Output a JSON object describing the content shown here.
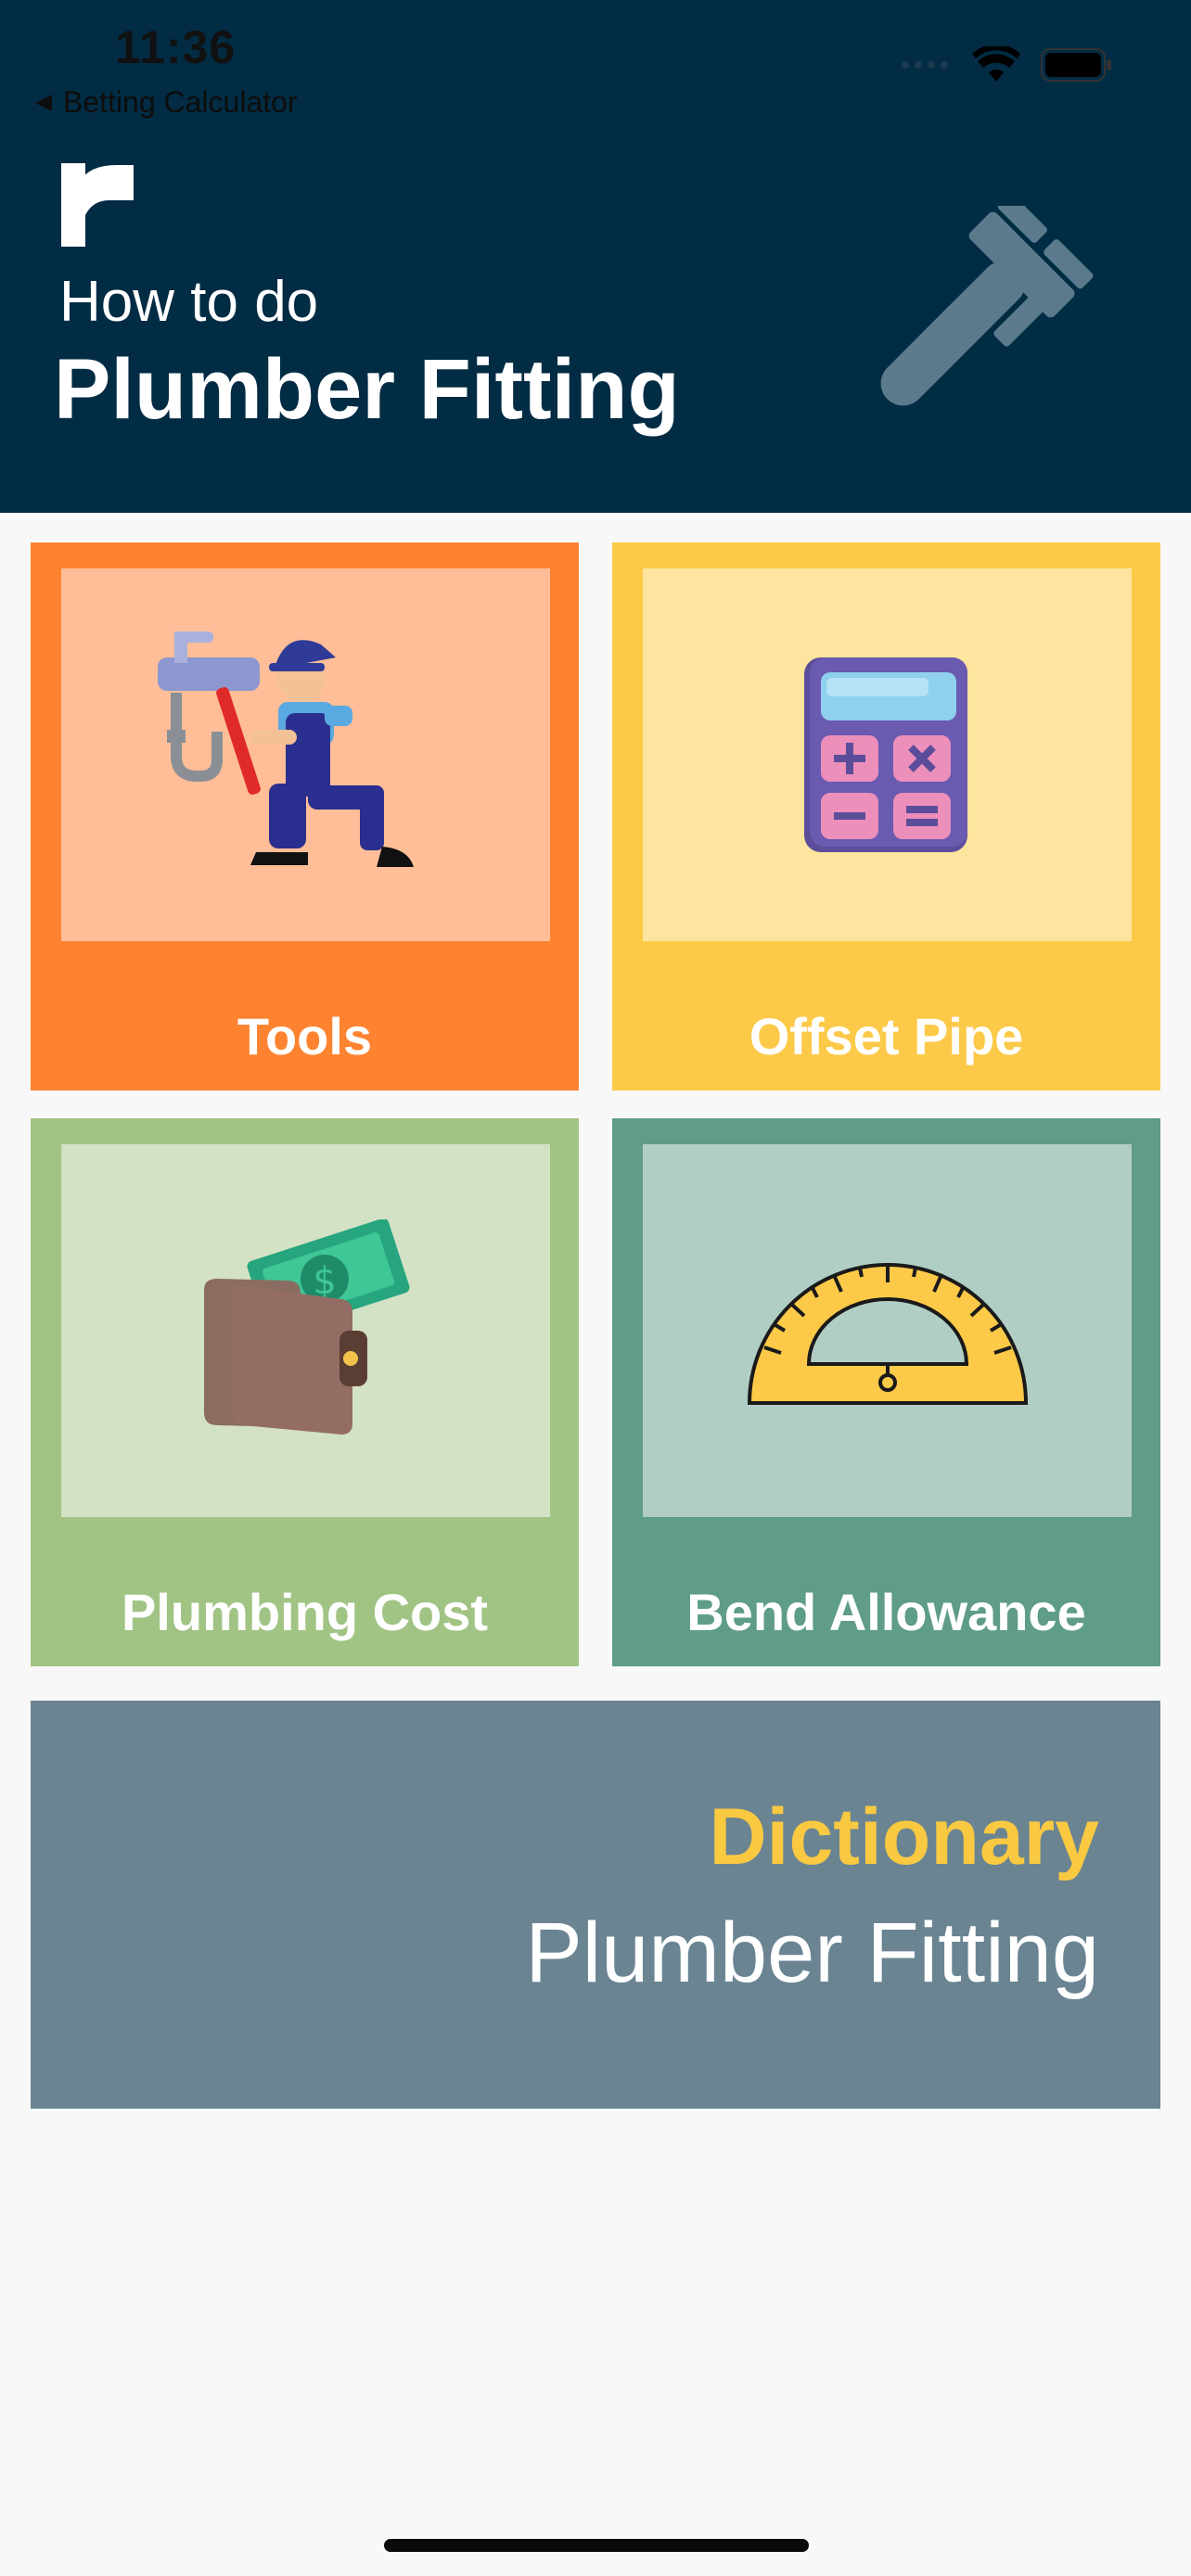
{
  "status_bar": {
    "time": "11:36",
    "back_label": "Betting Calculator"
  },
  "header": {
    "subtitle": "How to do",
    "title": "Plumber Fitting",
    "logo_icon": "r-logo-icon",
    "decor_icon": "wrench-icon"
  },
  "tiles": [
    {
      "label": "Tools",
      "icon": "plumber-with-wrench-icon",
      "outer_color": "#fe8330",
      "inner_color": "#ffbe97"
    },
    {
      "label": "Offset Pipe",
      "icon": "calculator-icon",
      "outer_color": "#fcc948",
      "inner_color": "#fee59f"
    },
    {
      "label": "Plumbing Cost",
      "icon": "wallet-money-icon",
      "outer_color": "#a1c384",
      "inner_color": "#d3e2c4"
    },
    {
      "label": "Bend Allowance",
      "icon": "protractor-icon",
      "outer_color": "#5f9c89",
      "inner_color": "#b0cec5"
    }
  ],
  "dictionary": {
    "title": "Dictionary",
    "subtitle": "Plumber Fitting",
    "color": "#6a8492"
  }
}
